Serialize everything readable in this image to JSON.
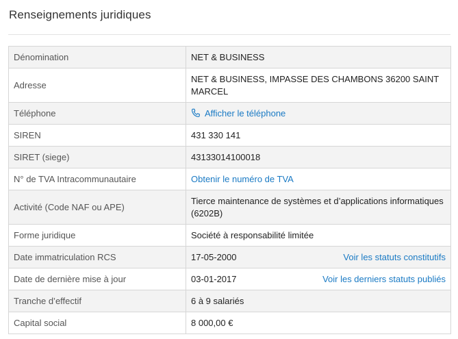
{
  "section": {
    "title": "Renseignements juridiques"
  },
  "rows": [
    {
      "label": "Dénomination",
      "value": "NET & BUSINESS"
    },
    {
      "label": "Adresse",
      "value": "NET & BUSINESS, IMPASSE DES CHAMBONS 36200 SAINT MARCEL"
    },
    {
      "label": "Téléphone",
      "value": "Afficher le téléphone",
      "icon": "phone-icon"
    },
    {
      "label": "SIREN",
      "value": "431 330 141"
    },
    {
      "label": "SIRET (siege)",
      "value": "43133014100018"
    },
    {
      "label": "N° de TVA Intracommunautaire",
      "value": "Obtenir le numéro de TVA"
    },
    {
      "label": "Activité (Code NAF ou APE)",
      "value": "Tierce maintenance de systèmes et d’applications informatiques (6202B)"
    },
    {
      "label": "Forme juridique",
      "value": "Société à responsabilité limitée"
    },
    {
      "label": "Date immatriculation RCS",
      "value": "17-05-2000",
      "action": "Voir les statuts constitutifs"
    },
    {
      "label": "Date de dernière mise à jour",
      "value": "03-01-2017",
      "action": "Voir les derniers statuts publiés"
    },
    {
      "label": "Tranche d’effectif",
      "value": "6 à 9 salariés"
    },
    {
      "label": "Capital social",
      "value": "8 000,00 €"
    }
  ],
  "colors": {
    "link": "#1a7ac4",
    "row_alt": "#f3f3f3",
    "border": "#d6d6d6"
  }
}
